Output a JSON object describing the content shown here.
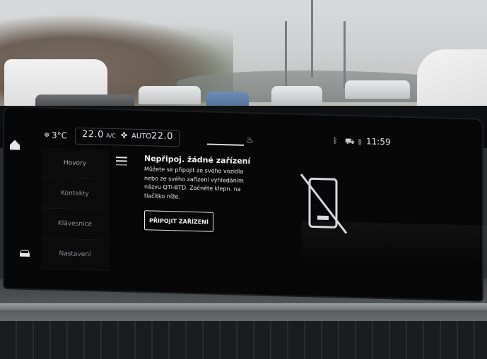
{
  "climate": {
    "outside_temp": "3°C",
    "fan_icon": "snowflake-fan-icon",
    "left_temp": "22.0",
    "ac_label": "A/C",
    "auto_fan_icon": "fan-icon",
    "auto_label": "AUTO",
    "right_temp": "22.0",
    "seat_icon": "seat-heat-icon"
  },
  "status": {
    "bluetooth_icon": "bluetooth-icon",
    "car_link_icon": "car-link-icon",
    "signal_icon": "signal-icon",
    "clock": "11:59"
  },
  "nav": {
    "items": [
      {
        "label": "Hovory"
      },
      {
        "label": "Kontakty"
      },
      {
        "label": "Klávesnice"
      },
      {
        "label": "Nastavení"
      }
    ]
  },
  "panel": {
    "title": "Nepřipoj. žádné zařízení",
    "text_lines": [
      "Můžete se připojit ze svého vozidla",
      "nebo ze svého zařízení vyhledáním",
      "názvu QTI-BTD. Začněte klepn. na",
      "tlačítko níže."
    ],
    "button_label": "PŘIPOJIT ZAŘÍZENÍ",
    "status_icon": "phone-disabled-icon"
  },
  "colors": {
    "screen_bg": "#070708",
    "text": "#e8e9ea",
    "nav_text": "#8d8f93"
  }
}
